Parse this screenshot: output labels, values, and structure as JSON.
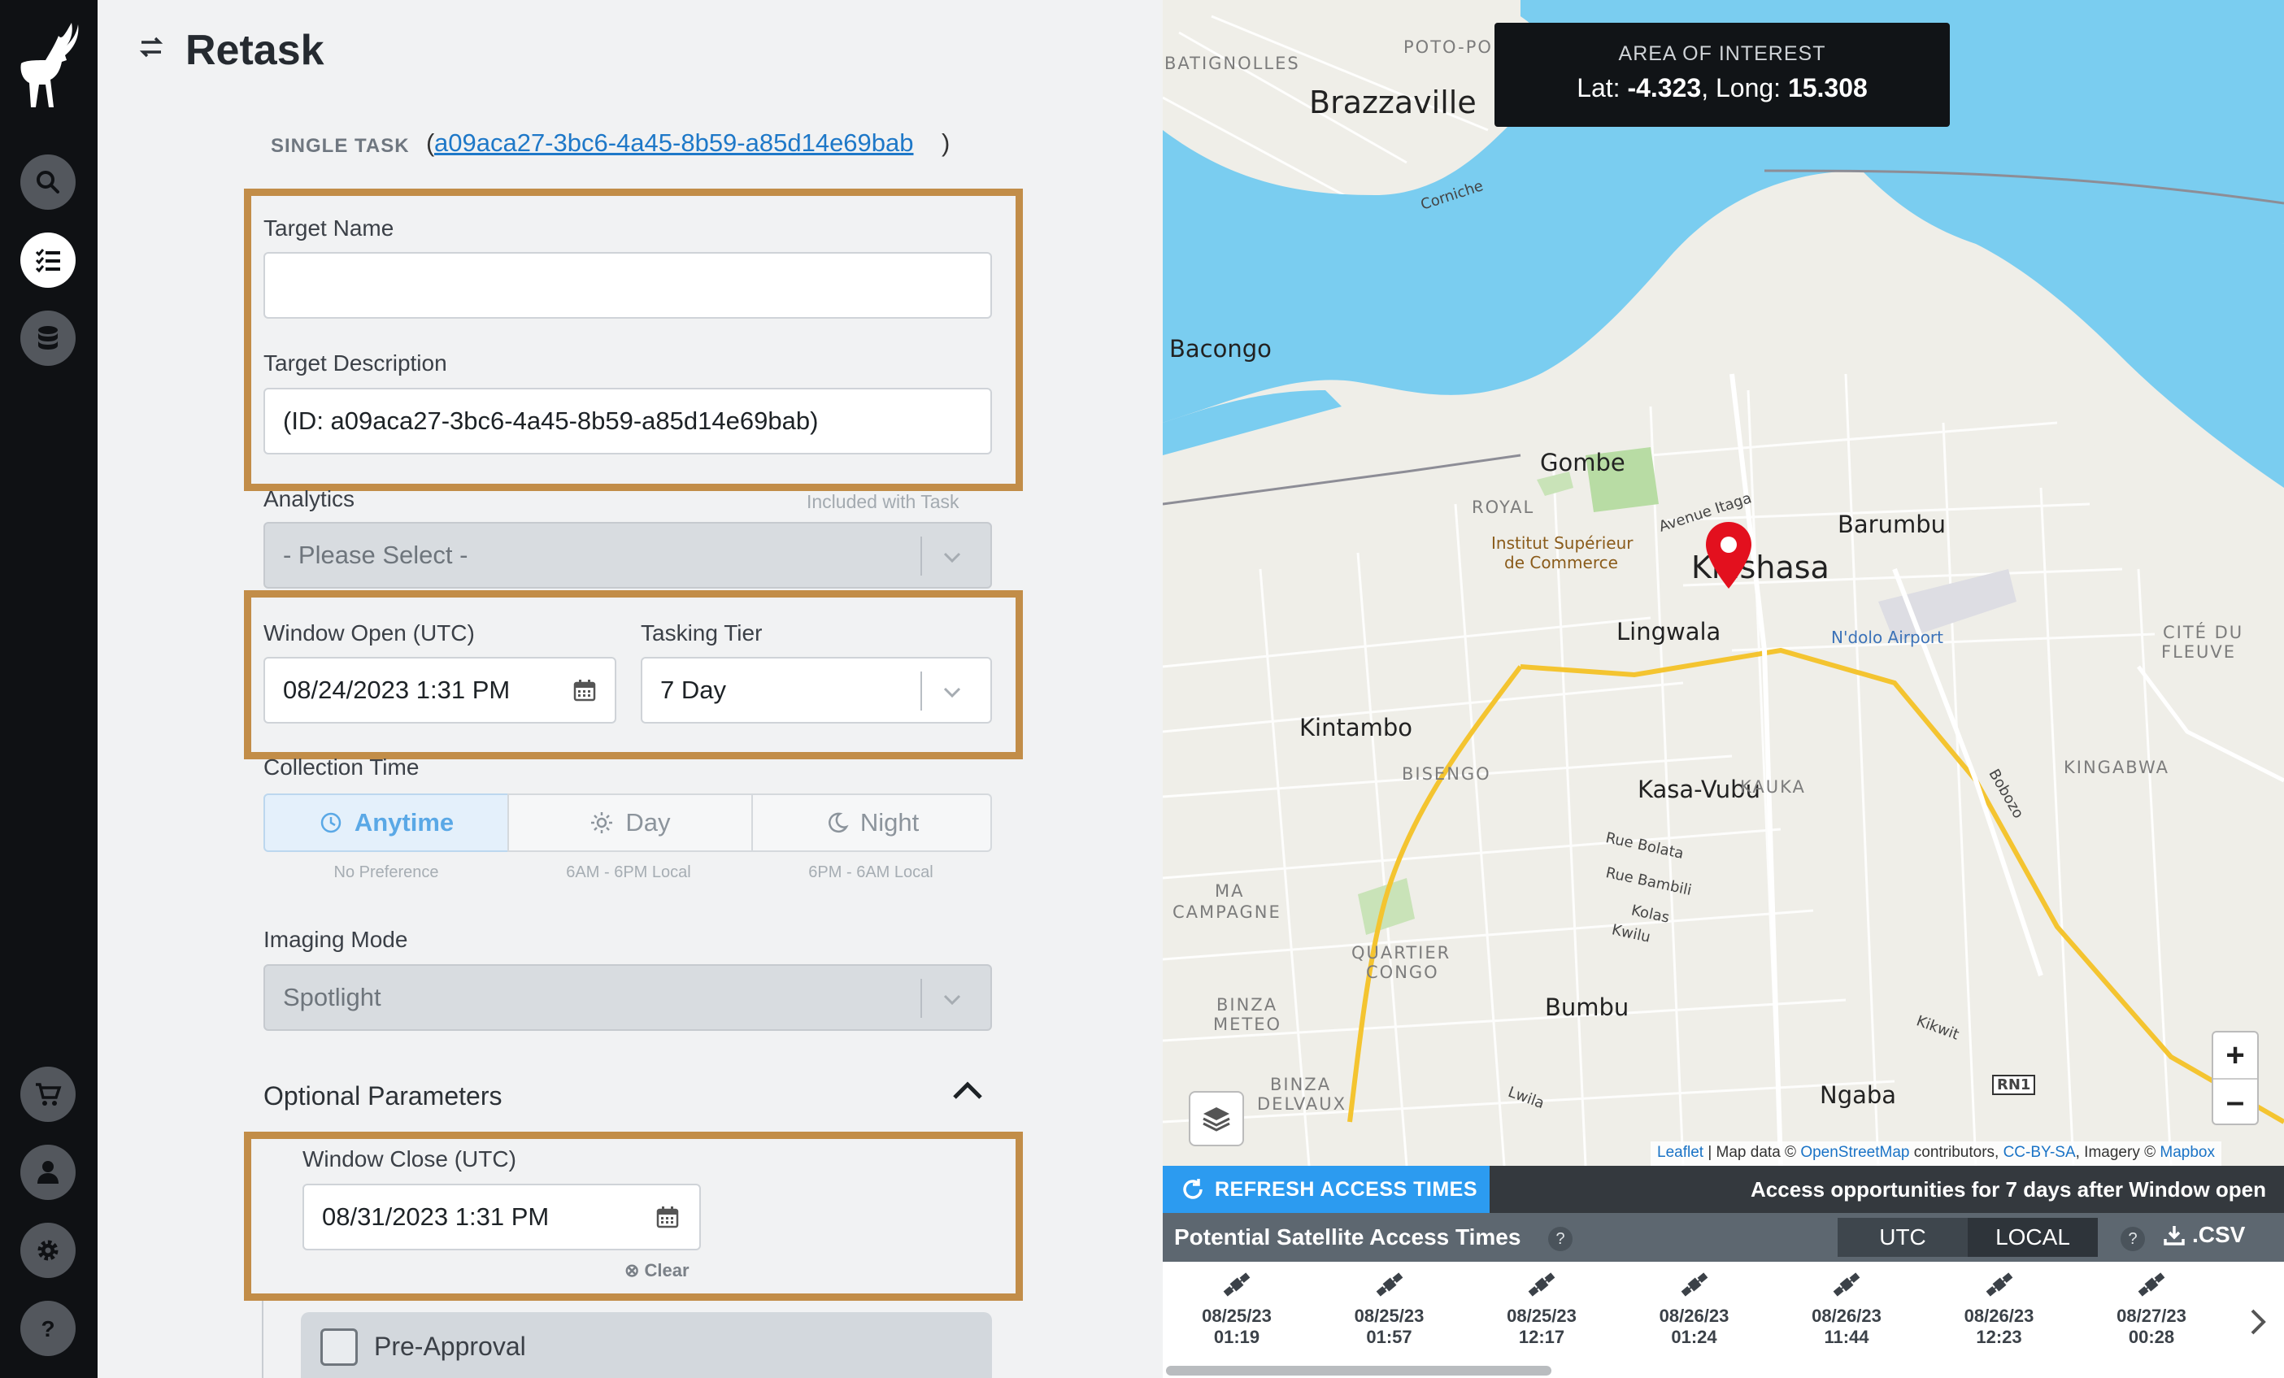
{
  "page": {
    "title": "Retask"
  },
  "task": {
    "label": "SINGLE TASK",
    "open_paren": "(",
    "close_paren": ")",
    "id_link": "a09aca27-3bc6-4a45-8b59-a85d14e69bab"
  },
  "form": {
    "target_name_label": "Target Name",
    "target_name_value": "",
    "target_description_label": "Target Description",
    "target_description_value": "(ID: a09aca27-3bc6-4a45-8b59-a85d14e69bab)",
    "analytics_label": "Analytics",
    "analytics_note": "Included with Task",
    "analytics_value": "- Please Select -",
    "window_open_label": "Window Open (UTC)",
    "window_open_value": "08/24/2023 1:31 PM",
    "tasking_tier_label": "Tasking Tier",
    "tasking_tier_value": "7 Day",
    "collection_time_label": "Collection Time",
    "collection_options": [
      {
        "label": "Anytime",
        "sub": "No Preference",
        "selected": true,
        "icon": "clock-icon"
      },
      {
        "label": "Day",
        "sub": "6AM - 6PM Local",
        "selected": false,
        "icon": "sun-icon"
      },
      {
        "label": "Night",
        "sub": "6PM - 6AM Local",
        "selected": false,
        "icon": "moon-icon"
      }
    ],
    "imaging_mode_label": "Imaging Mode",
    "imaging_mode_value": "Spotlight",
    "optional_parameters_label": "Optional Parameters",
    "window_close_label": "Window Close (UTC)",
    "window_close_value": "08/31/2023 1:31 PM",
    "clear_label": "Clear",
    "pre_approval_label": "Pre-Approval"
  },
  "map": {
    "aoi_title": "AREA OF INTEREST",
    "lat_label": "Lat:",
    "lat_value": "-4.323",
    "long_label": "Long:",
    "long_value": "15.308",
    "labels": {
      "brazzaville": "Brazzaville",
      "kinshasa": "Kinshasa",
      "gombe": "Gombe",
      "barumbu": "Barumbu",
      "lingwala": "Lingwala",
      "kintambo": "Kintambo",
      "kasa_vubu": "Kasa-Vubu",
      "bumbu": "Bumbu",
      "ngaba": "Ngaba",
      "bacongo": "Bacongo",
      "batignolles": "BATIGNOLLES",
      "poto_po": "POTO-PO",
      "royal": "ROYAL",
      "bisengo": "BISENGO",
      "kauka": "KAUKA",
      "kingabwa": "KINGABWA",
      "cite_du": "CITÉ DU",
      "fleuve": "FLEUVE",
      "ma": "MA",
      "campagne": "CAMPAGNE",
      "quartier": "QUARTIER",
      "congo": "CONGO",
      "binza": "BINZA",
      "meteo": "METEO",
      "binza2": "BINZA",
      "delvaux": "DELVAUX",
      "institut1": "Institut Supérieur",
      "institut2": "de Commerce",
      "ndolo": "N'dolo Airport",
      "corniche": "Corniche",
      "avenue_itaga": "Avenue Itaga",
      "rue_bolata": "Rue Bolata",
      "rue_bambili": "Rue Bambili",
      "kolas": "Kolas",
      "kwilu": "Kwilu",
      "lwila": "Lwila",
      "kikwit": "Kikwit",
      "bobozo": "Bobozo",
      "rn1": "RN1"
    },
    "attribution": {
      "leaflet": "Leaflet",
      "text1": " | Map data © ",
      "osm": "OpenStreetMap",
      "text2": " contributors, ",
      "ccbysa": "CC-BY-SA",
      "text3": ", Imagery © ",
      "mapbox": "Mapbox"
    },
    "zoom_in": "+",
    "zoom_out": "–"
  },
  "access": {
    "refresh_label": "REFRESH ACCESS TIMES",
    "message": "Access opportunities for 7 days after Window open",
    "title": "Potential Satellite Access Times",
    "help": "?",
    "utc_label": "UTC",
    "local_label": "LOCAL",
    "csv_label": ".CSV",
    "times": [
      {
        "date": "08/25/23",
        "time": "01:19"
      },
      {
        "date": "08/25/23",
        "time": "01:57"
      },
      {
        "date": "08/25/23",
        "time": "12:17"
      },
      {
        "date": "08/26/23",
        "time": "01:24"
      },
      {
        "date": "08/26/23",
        "time": "11:44"
      },
      {
        "date": "08/26/23",
        "time": "12:23"
      },
      {
        "date": "08/27/23",
        "time": "00:28"
      }
    ]
  },
  "colors": {
    "highlight": "#c28d48",
    "accent_blue": "#2c9bf0",
    "river": "#7acdf0",
    "marker": "#e3101e"
  }
}
